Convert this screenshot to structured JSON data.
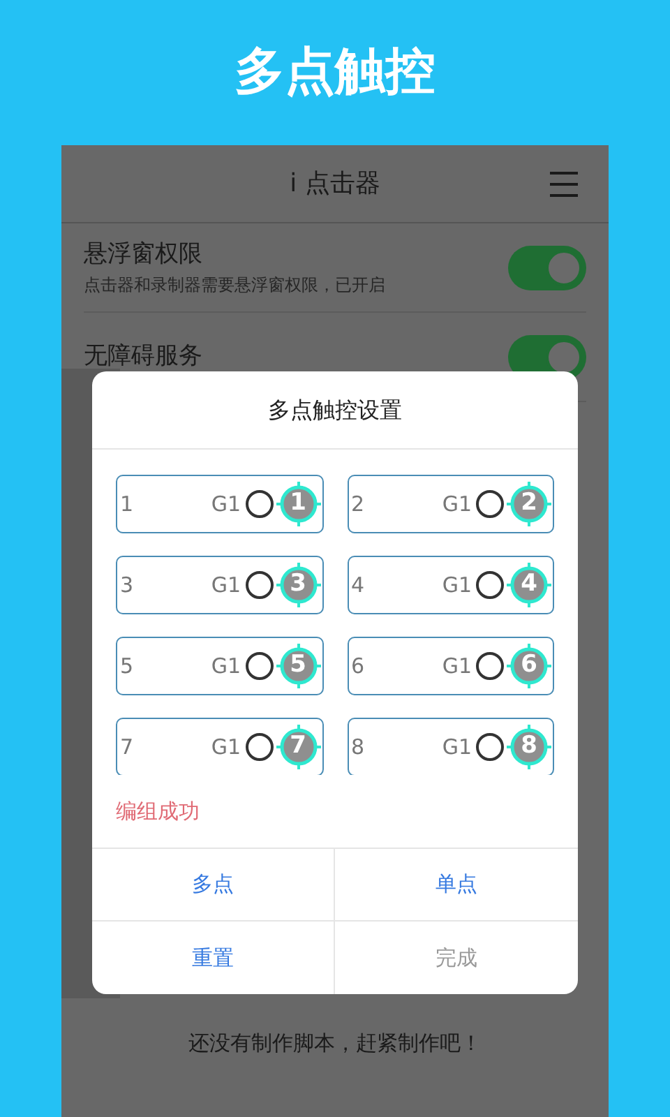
{
  "banner": {
    "title": "多点触控"
  },
  "app": {
    "title": "i 点击器"
  },
  "settings": [
    {
      "title": "悬浮窗权限",
      "subtitle": "点击器和录制器需要悬浮窗权限，已开启",
      "on": true
    },
    {
      "title": "无障碍服务",
      "on": true
    }
  ],
  "empty_message": "还没有制作脚本，赶紧制作吧！",
  "dialog": {
    "title": "多点触控设置",
    "points": [
      {
        "index": "1",
        "group": "G1",
        "checked": false,
        "badge": "1"
      },
      {
        "index": "2",
        "group": "G1",
        "checked": false,
        "badge": "2"
      },
      {
        "index": "3",
        "group": "G1",
        "checked": false,
        "badge": "3"
      },
      {
        "index": "4",
        "group": "G1",
        "checked": false,
        "badge": "4"
      },
      {
        "index": "5",
        "group": "G1",
        "checked": false,
        "badge": "5"
      },
      {
        "index": "6",
        "group": "G1",
        "checked": false,
        "badge": "6"
      },
      {
        "index": "7",
        "group": "G1",
        "checked": false,
        "badge": "7"
      },
      {
        "index": "8",
        "group": "G1",
        "checked": false,
        "badge": "8"
      }
    ],
    "status": "编组成功",
    "buttons": [
      {
        "label": "多点",
        "disabled": false
      },
      {
        "label": "单点",
        "disabled": false
      },
      {
        "label": "重置",
        "disabled": false
      },
      {
        "label": "完成",
        "disabled": true
      }
    ]
  }
}
